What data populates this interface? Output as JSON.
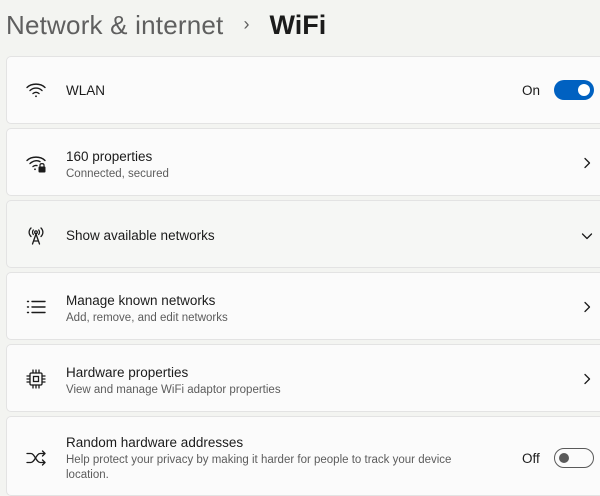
{
  "breadcrumb": {
    "parent": "Network & internet",
    "separator": "›",
    "current": "WiFi"
  },
  "rows": [
    {
      "icon": "wifi-icon",
      "title": "WLAN",
      "toggle": {
        "label": "On",
        "state": "on"
      }
    },
    {
      "icon": "wifi-lock-icon",
      "title": "160 properties",
      "subtitle": "Connected, secured",
      "action": "chevron-right-icon"
    },
    {
      "icon": "antenna-icon",
      "title": "Show available networks",
      "action": "chevron-down-icon"
    },
    {
      "icon": "list-icon",
      "title": "Manage known networks",
      "subtitle": "Add, remove, and edit networks",
      "action": "chevron-right-icon"
    },
    {
      "icon": "chip-icon",
      "title": "Hardware properties",
      "subtitle": "View and manage WiFi adaptor properties",
      "action": "chevron-right-icon"
    },
    {
      "icon": "shuffle-icon",
      "title": "Random hardware addresses",
      "subtitle_line1": "Help protect your privacy by making it harder for people to track your device",
      "subtitle_line2": "location.",
      "toggle": {
        "label": "Off",
        "state": "off"
      }
    }
  ],
  "colors": {
    "accent": "#0061c1",
    "background": "#f3f4f1",
    "card": "#fbfbfb"
  }
}
